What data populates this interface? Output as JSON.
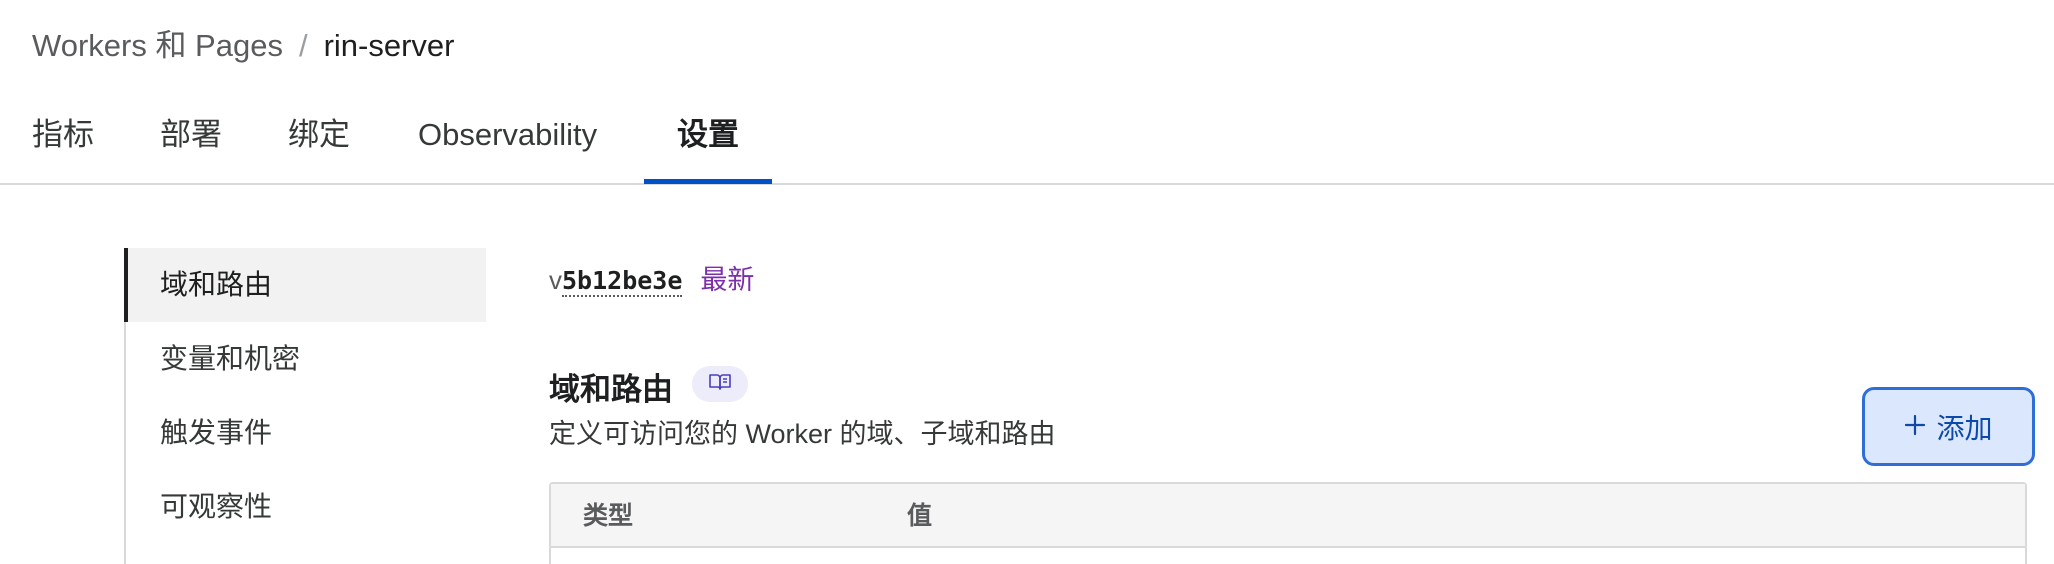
{
  "breadcrumb": {
    "parent": "Workers 和 Pages",
    "separator": "/",
    "current": "rin-server"
  },
  "tabs": [
    {
      "label": "指标",
      "active": false
    },
    {
      "label": "部署",
      "active": false
    },
    {
      "label": "绑定",
      "active": false
    },
    {
      "label": "Observability",
      "active": false
    },
    {
      "label": "设置",
      "active": true
    }
  ],
  "sidenav": {
    "items": [
      {
        "label": "域和路由",
        "active": true
      },
      {
        "label": "变量和机密",
        "active": false
      },
      {
        "label": "触发事件",
        "active": false
      },
      {
        "label": "可观察性",
        "active": false
      }
    ]
  },
  "version": {
    "prefix": "v",
    "hash": "5b12be3e",
    "badge": "最新"
  },
  "section": {
    "title": "域和路由",
    "description": "定义可访问您的 Worker 的域、子域和路由",
    "docs_icon": "book-open-icon"
  },
  "add_button": {
    "label": "添加",
    "icon": "plus-icon"
  },
  "table": {
    "columns": [
      "类型",
      "值"
    ]
  },
  "colors": {
    "accent": "#0051c3",
    "badge": "#7b2fa8",
    "button_bg": "#dbe7fc",
    "button_border": "#2f6ed6"
  }
}
